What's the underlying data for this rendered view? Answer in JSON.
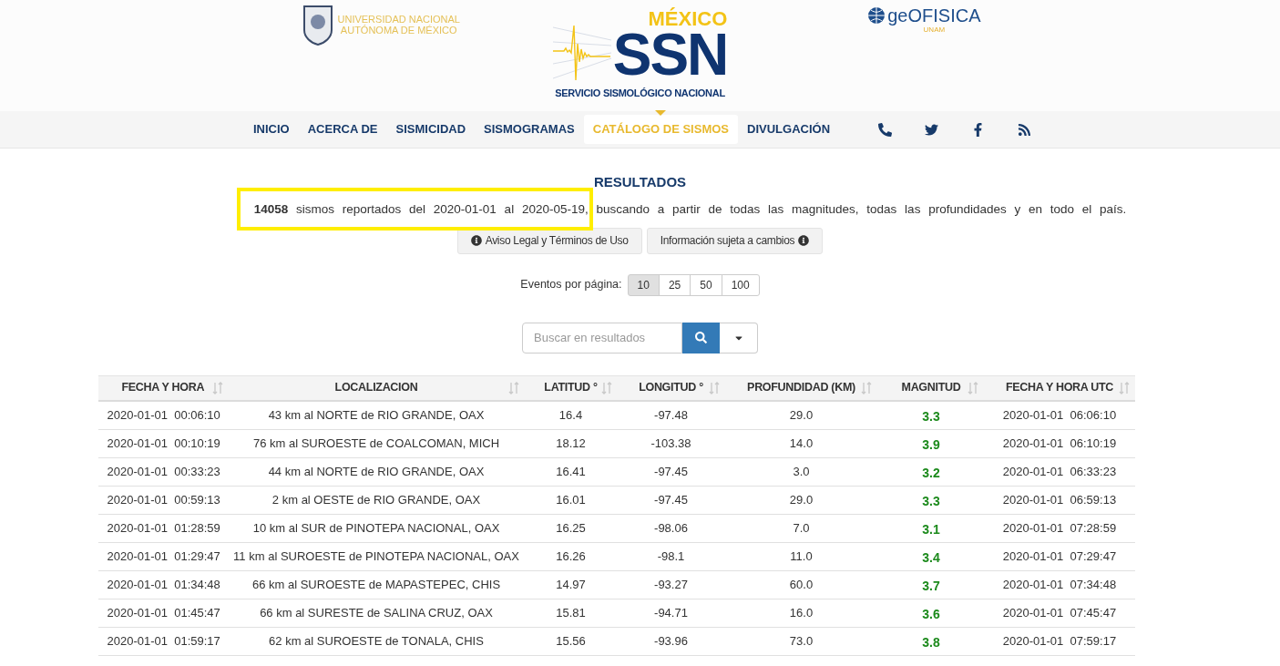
{
  "header": {
    "unam_logo": {
      "line1": "UNIVERSIDAD NACIONAL",
      "line2": "AUTÓNOMA DE MÉXICO"
    },
    "ssn_logo": {
      "country": "MÉXICO",
      "acronym": "SSN",
      "name": "SERVICIO SISMOLÓGICO NACIONAL"
    },
    "geofisica_logo": {
      "word": "geOFISICA",
      "sub": "UNAM"
    }
  },
  "nav": [
    {
      "label": "INICIO",
      "selected": false
    },
    {
      "label": "ACERCA DE",
      "selected": false
    },
    {
      "label": "SISMICIDAD",
      "selected": false
    },
    {
      "label": "SISMOGRAMAS",
      "selected": false
    },
    {
      "label": "CATÁLOGO DE SISMOS",
      "selected": true
    },
    {
      "label": "DIVULGACIÓN",
      "selected": false
    }
  ],
  "results": {
    "title": "RESULTADOS",
    "summary": "**14058** sismos reportados del 2020-01-01 al 2020-05-19, buscando a partir de todas las magnitudes, todas las profundidades y en todo el país.",
    "highlighted": true,
    "buttons": [
      "Aviso Legal y Términos de Uso",
      "Información sujeta a cambios"
    ]
  },
  "page_size": {
    "label": "Eventos por página:",
    "options": [
      {
        "label": "10",
        "selected": true
      },
      {
        "label": "25",
        "selected": false
      },
      {
        "label": "50",
        "selected": false
      },
      {
        "label": "100",
        "selected": false
      }
    ]
  },
  "search": {
    "placeholder": "Buscar en resultados"
  },
  "table": {
    "columns": [
      "FECHA Y HORA",
      "LOCALIZACION",
      "LATITUD °",
      "LONGITUD °",
      "PROFUNDIDAD (KM)",
      "MAGNITUD",
      "FECHA Y HORA UTC"
    ],
    "rows": [
      [
        "2020-01-01  00:06:10",
        "43 km al NORTE de RIO GRANDE, OAX",
        "16.4",
        "-97.48",
        "29.0",
        "3.3",
        "2020-01-01  06:06:10"
      ],
      [
        "2020-01-01  00:10:19",
        "76 km al SUROESTE de COALCOMAN, MICH",
        "18.12",
        "-103.38",
        "14.0",
        "3.9",
        "2020-01-01  06:10:19"
      ],
      [
        "2020-01-01  00:33:23",
        "44 km al NORTE de RIO GRANDE, OAX",
        "16.41",
        "-97.45",
        "3.0",
        "3.2",
        "2020-01-01  06:33:23"
      ],
      [
        "2020-01-01  00:59:13",
        "2 km al OESTE de RIO GRANDE, OAX",
        "16.01",
        "-97.45",
        "29.0",
        "3.3",
        "2020-01-01  06:59:13"
      ],
      [
        "2020-01-01  01:28:59",
        "10 km al SUR de PINOTEPA NACIONAL, OAX",
        "16.25",
        "-98.06",
        "7.0",
        "3.1",
        "2020-01-01  07:28:59"
      ],
      [
        "2020-01-01  01:29:47",
        "11 km al SUROESTE de PINOTEPA NACIONAL, OAX",
        "16.26",
        "-98.1",
        "11.0",
        "3.4",
        "2020-01-01  07:29:47"
      ],
      [
        "2020-01-01  01:34:48",
        "66 km al SUROESTE de MAPASTEPEC, CHIS",
        "14.97",
        "-93.27",
        "60.0",
        "3.7",
        "2020-01-01  07:34:48"
      ],
      [
        "2020-01-01  01:45:47",
        "66 km al SURESTE de SALINA CRUZ, OAX",
        "15.81",
        "-94.71",
        "16.0",
        "3.6",
        "2020-01-01  07:45:47"
      ],
      [
        "2020-01-01  01:59:17",
        "62 km al SUROESTE de TONALA, CHIS",
        "15.56",
        "-93.96",
        "73.0",
        "3.8",
        "2020-01-01  07:59:17"
      ]
    ]
  }
}
